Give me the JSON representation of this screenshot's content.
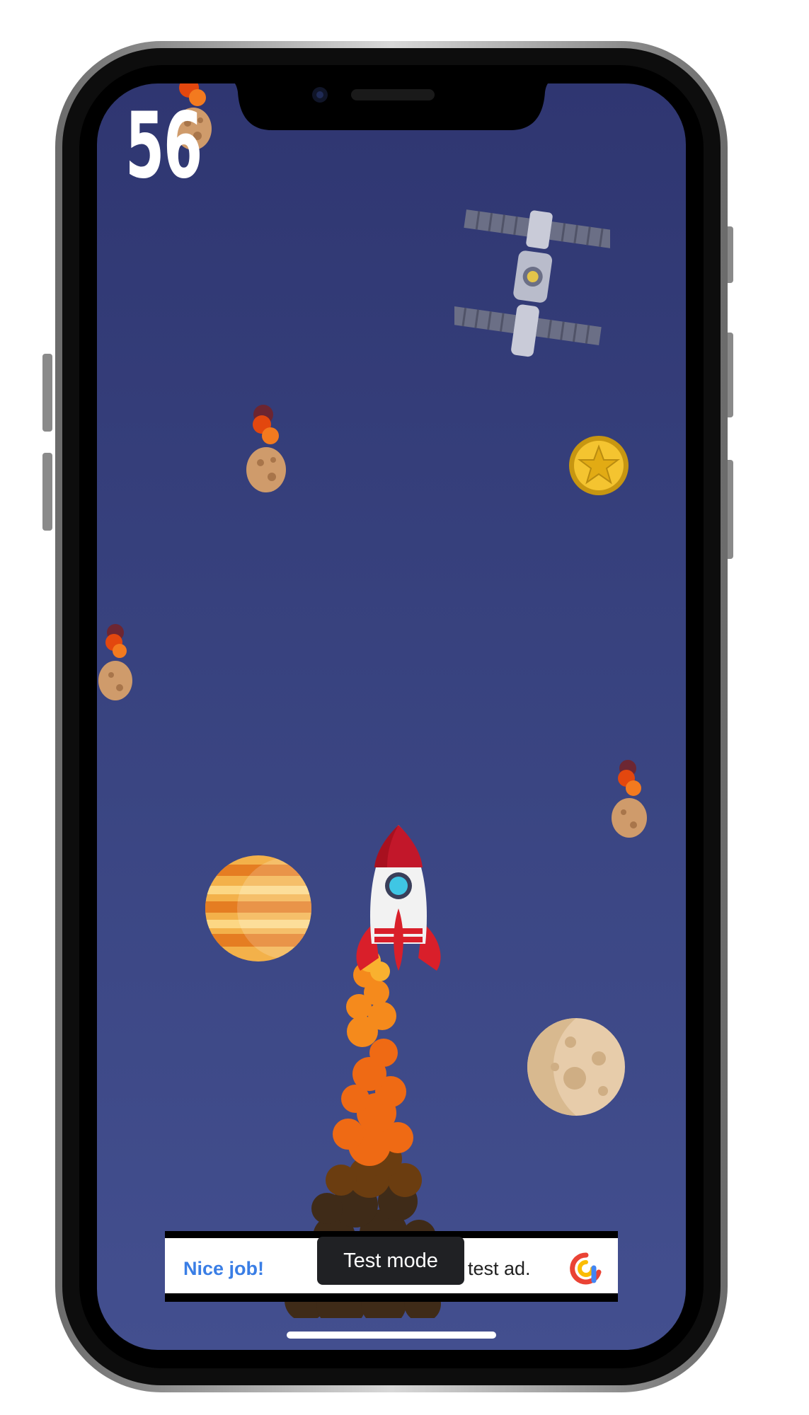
{
  "game": {
    "score": "56"
  },
  "ad": {
    "headline": "Nice job!",
    "badge": "Test mode",
    "body": "test ad."
  },
  "icons": [
    "meteor-icon",
    "satellite-icon",
    "coin-icon",
    "rocket-icon",
    "planet-icon",
    "moon-icon",
    "ad-choices-icon"
  ],
  "colors": {
    "space_background": "#363f7b",
    "score_text": "#ffffff",
    "ad_headline": "#3a7ee5",
    "badge_background": "#202124"
  }
}
